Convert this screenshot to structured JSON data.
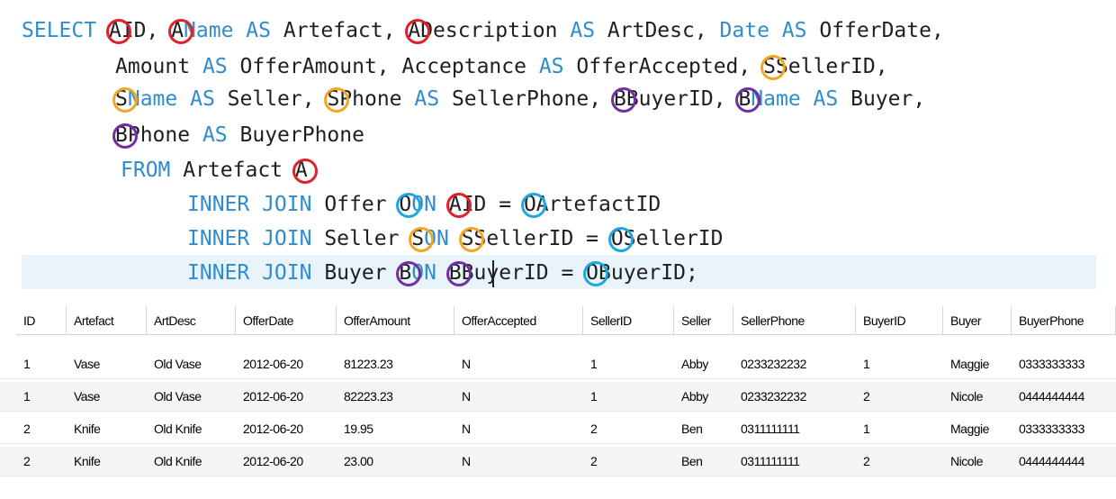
{
  "editor": {
    "tokens": [
      [
        [
          "kw",
          "SELECT "
        ],
        [
          "al",
          "A",
          "#e0202a"
        ],
        [
          "tx",
          "ID, "
        ],
        [
          "al",
          "A",
          "#e0202a"
        ],
        [
          "kw",
          "Name "
        ],
        [
          "kw",
          "AS "
        ],
        [
          "tx",
          "Artefact, "
        ],
        [
          "al",
          "A",
          "#e0202a"
        ],
        [
          "tx",
          "Description "
        ],
        [
          "kw",
          "AS "
        ],
        [
          "tx",
          "ArtDesc, "
        ],
        [
          "kw",
          "Date "
        ],
        [
          "kw",
          "AS "
        ],
        [
          "tx",
          "OfferDate,"
        ]
      ],
      [
        [
          "tx",
          "Amount "
        ],
        [
          "kw",
          "AS "
        ],
        [
          "tx",
          "OfferAmount, Acceptance "
        ],
        [
          "kw",
          "AS "
        ],
        [
          "tx",
          "OfferAccepted, "
        ],
        [
          "al",
          "S",
          "#f4a623"
        ],
        [
          "tx",
          "SellerID,"
        ]
      ],
      [
        [
          "al",
          "S",
          "#f4a623"
        ],
        [
          "kw",
          "Name "
        ],
        [
          "kw",
          "AS "
        ],
        [
          "tx",
          "Seller, "
        ],
        [
          "al",
          "S",
          "#f4a623"
        ],
        [
          "tx",
          "Phone "
        ],
        [
          "kw",
          "AS "
        ],
        [
          "tx",
          "SellerPhone, "
        ],
        [
          "al",
          "B",
          "#7030a0"
        ],
        [
          "tx",
          "BuyerID, "
        ],
        [
          "al",
          "B",
          "#7030a0"
        ],
        [
          "kw",
          "Name "
        ],
        [
          "kw",
          "AS "
        ],
        [
          "tx",
          "Buyer,"
        ]
      ],
      [
        [
          "al",
          "B",
          "#7030a0"
        ],
        [
          "tx",
          "Phone "
        ],
        [
          "kw",
          "AS "
        ],
        [
          "tx",
          "BuyerPhone"
        ]
      ],
      [
        [
          "kw",
          "FROM "
        ],
        [
          "tx",
          "Artefact "
        ],
        [
          "al",
          "A",
          "#e0202a"
        ]
      ],
      [
        [
          "kw",
          "INNER JOIN "
        ],
        [
          "tx",
          "Offer "
        ],
        [
          "al",
          "O",
          "#1ea7e1"
        ],
        [
          "kw",
          "ON "
        ],
        [
          "al",
          "A",
          "#e0202a"
        ],
        [
          "tx",
          "ID = "
        ],
        [
          "al",
          "O",
          "#1ea7e1"
        ],
        [
          "tx",
          "ArtefactID"
        ]
      ],
      [
        [
          "kw",
          "INNER JOIN "
        ],
        [
          "tx",
          "Seller "
        ],
        [
          "al",
          "S",
          "#f4a623"
        ],
        [
          "kw",
          "ON "
        ],
        [
          "al",
          "S",
          "#f4a623"
        ],
        [
          "tx",
          "SellerID = "
        ],
        [
          "al",
          "O",
          "#1ea7e1"
        ],
        [
          "tx",
          "SellerID"
        ]
      ],
      [
        [
          "kw",
          "INNER JOIN "
        ],
        [
          "tx",
          "Buyer "
        ],
        [
          "al",
          "B",
          "#7030a0"
        ],
        [
          "kw",
          "ON "
        ],
        [
          "al",
          "B",
          "#7030a0"
        ],
        [
          "tx",
          "BuyerID = "
        ],
        [
          "al",
          "O",
          "#1ea7e1"
        ],
        [
          "tx",
          "BuyerID;"
        ]
      ]
    ],
    "colors": {
      "keyword": "#2e8ccf",
      "alias_a": "#e0202a",
      "alias_s": "#f4a623",
      "alias_b": "#7030a0",
      "alias_o": "#1ea7e1"
    }
  },
  "results": {
    "columns": [
      "ID",
      "Artefact",
      "ArtDesc",
      "OfferDate",
      "OfferAmount",
      "OfferAccepted",
      "SellerID",
      "Seller",
      "SellerPhone",
      "BuyerID",
      "Buyer",
      "BuyerPhone"
    ],
    "rows": [
      [
        "1",
        "Vase",
        "Old Vase",
        "2012-06-20",
        "81223.23",
        "N",
        "1",
        "Abby",
        "0233232232",
        "1",
        "Maggie",
        "0333333333"
      ],
      [
        "1",
        "Vase",
        "Old Vase",
        "2012-06-20",
        "82223.23",
        "N",
        "1",
        "Abby",
        "0233232232",
        "2",
        "Nicole",
        "0444444444"
      ],
      [
        "2",
        "Knife",
        "Old Knife",
        "2012-06-20",
        "19.95",
        "N",
        "2",
        "Ben",
        "0311111111",
        "1",
        "Maggie",
        "0333333333"
      ],
      [
        "2",
        "Knife",
        "Old Knife",
        "2012-06-20",
        "23.00",
        "N",
        "2",
        "Ben",
        "0311111111",
        "2",
        "Nicole",
        "0444444444"
      ]
    ]
  }
}
